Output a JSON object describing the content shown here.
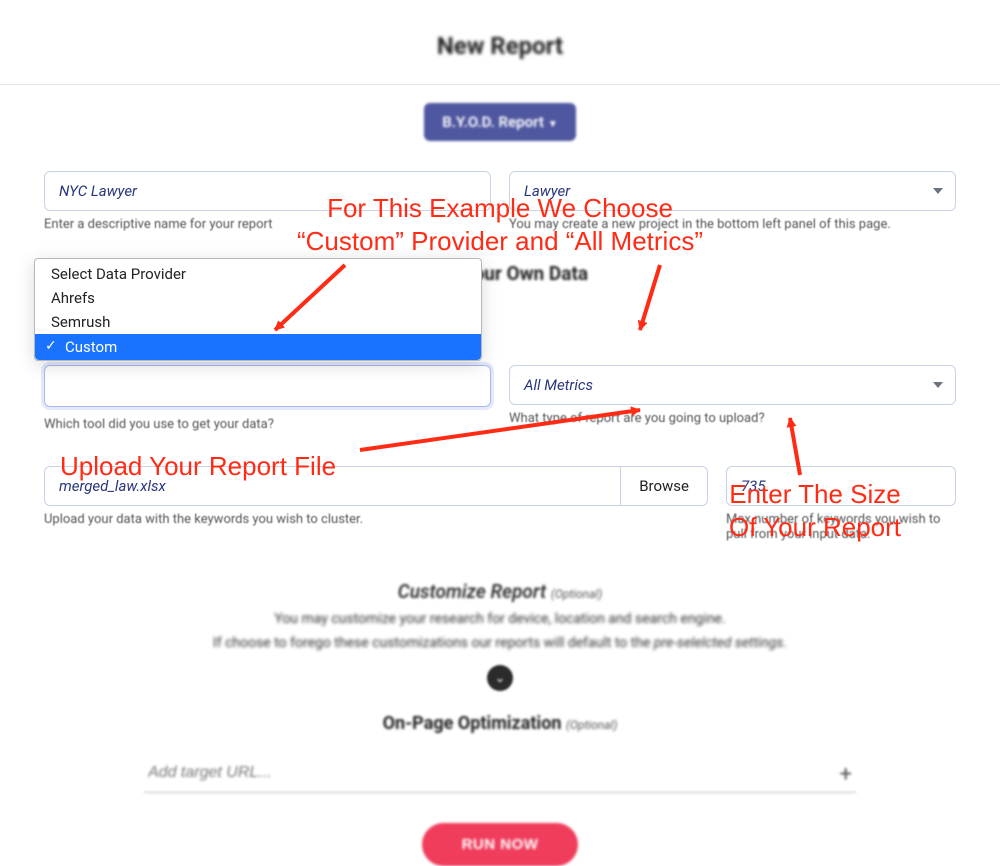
{
  "title": "New Report",
  "byod_button": "B.Y.O.D. Report",
  "name_input": {
    "value": "NYC Lawyer",
    "helper": "Enter a descriptive name for your report"
  },
  "project_select": {
    "value": "Lawyer",
    "helper": "You may create a new project in the bottom left panel of this page."
  },
  "byod_section_heading": "Bring Your Own Data",
  "provider_dropdown": {
    "items": [
      "Select Data Provider",
      "Ahrefs",
      "Semrush",
      "Custom"
    ],
    "selected": "Custom",
    "helper": "Which tool did you use to get your data?"
  },
  "metrics_select": {
    "value": "All Metrics",
    "helper": "What type of report are you going to upload?"
  },
  "file_upload": {
    "file_name": "merged_law.xlsx",
    "browse_label": "Browse",
    "helper": "Upload your data with the keywords you wish to cluster."
  },
  "max_keywords": {
    "value": "735",
    "helper": "Max number of keywords you wish to pull from your input data."
  },
  "customize": {
    "heading": "Customize Report",
    "optional": "(Optional)",
    "line1": "You may customize your research for device, location and search engine.",
    "line2_a": "If choose to forego these customizations our reports will default to the ",
    "line2_b": "pre-selelcted settings",
    "line2_c": "."
  },
  "onpage": {
    "heading": "On-Page Optimization",
    "optional": "(Optional)",
    "placeholder": "Add target URL..."
  },
  "run_button": "RUN NOW",
  "annotations": {
    "top": "For This Example We Choose\n“Custom” Provider and “All Metrics”",
    "upload": "Upload Your Report File",
    "size": "Enter The Size\nOf Your Report"
  }
}
